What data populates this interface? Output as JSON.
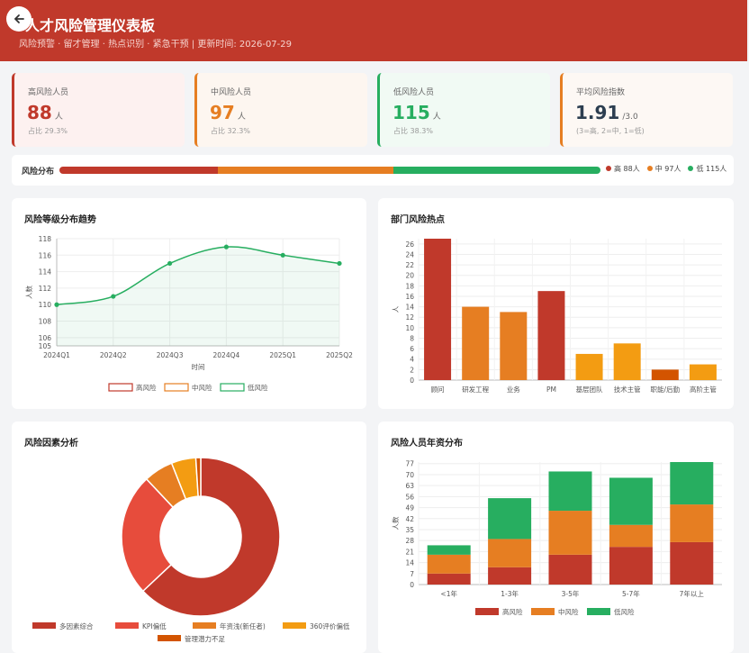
{
  "header": {
    "title": "人才风险管理仪表板",
    "subtitle": "风险预警 · 留才管理 · 热点识别 · 紧急干预 | 更新时间: 2026-07-29"
  },
  "kpis": [
    {
      "label": "高风险人员",
      "value": "88",
      "unit": "人",
      "note": "占比 29.3%",
      "color": "#c0392b",
      "bg": "#fdf1f0"
    },
    {
      "label": "中风险人员",
      "value": "97",
      "unit": "人",
      "note": "占比 32.3%",
      "color": "#e67e22",
      "bg": "#fdf6f0"
    },
    {
      "label": "低风险人员",
      "value": "115",
      "unit": "人",
      "note": "占比 38.3%",
      "color": "#27ae60",
      "bg": "#f1faf4"
    },
    {
      "label": "平均风险指数",
      "value": "1.91",
      "unit": "/3.0",
      "note": "(3=高, 2=中, 1=低)",
      "color": "#e67e22",
      "bg": "#fdf8f4"
    }
  ],
  "distribution": {
    "label": "风险分布",
    "segments": [
      {
        "name": "高",
        "count": 88,
        "text": "高 88人",
        "color": "#c0392b"
      },
      {
        "name": "中",
        "count": 97,
        "text": "中 97人",
        "color": "#e67e22"
      },
      {
        "name": "低",
        "count": 115,
        "text": "低 115人",
        "color": "#27ae60"
      }
    ]
  },
  "cards": {
    "trend_title": "风险等级分布趋势",
    "dept_title": "部门风险热点",
    "factor_title": "风险因素分析",
    "tenure_title": "风险人员年资分布"
  },
  "chart_data": [
    {
      "type": "line",
      "title": "风险等级分布趋势",
      "xlabel": "时间",
      "ylabel": "人数",
      "categories": [
        "2024Q1",
        "2024Q2",
        "2024Q3",
        "2024Q4",
        "2025Q1",
        "2025Q2"
      ],
      "yticks": [
        "105",
        "106",
        "108",
        "110",
        "112",
        "114",
        "116",
        "118"
      ],
      "ylim": [
        105,
        118
      ],
      "series": [
        {
          "name": "低风险",
          "values": [
            110,
            111,
            115,
            117,
            116,
            115
          ],
          "color": "#27ae60"
        }
      ],
      "legend": [
        {
          "name": "高风险",
          "color": "#c0392b"
        },
        {
          "name": "中风险",
          "color": "#e67e22"
        },
        {
          "name": "低风险",
          "color": "#27ae60"
        }
      ],
      "grid": true
    },
    {
      "type": "bar",
      "title": "部门风险热点",
      "ylabel": "人",
      "categories": [
        "顾问",
        "研发工程",
        "业务",
        "PM",
        "基层团队",
        "技术主管",
        "职能/后勤",
        "高阶主管"
      ],
      "values": [
        27,
        14,
        13,
        17,
        5,
        7,
        2,
        3
      ],
      "colors": [
        "#c0392b",
        "#e67e22",
        "#e67e22",
        "#c0392b",
        "#f39c12",
        "#f39c12",
        "#d35400",
        "#f39c12"
      ],
      "ylim": [
        0,
        27
      ],
      "yticks": [
        "0",
        "2",
        "4",
        "6",
        "8",
        "10",
        "12",
        "14",
        "16",
        "18",
        "20",
        "22",
        "24",
        "26"
      ],
      "grid": true
    },
    {
      "type": "pie",
      "title": "风险因素分析",
      "labels": [
        "多因素综合",
        "KPI偏低",
        "年资浅(新任者)",
        "360评价偏低",
        "管理潜力不足"
      ],
      "values": [
        63,
        25,
        6,
        5,
        1
      ],
      "colors": [
        "#c0392b",
        "#e74c3c",
        "#e67e22",
        "#f39c12",
        "#d35400"
      ]
    },
    {
      "type": "bar",
      "title": "风险人员年资分布",
      "ylabel": "人数",
      "categories": [
        "<1年",
        "1-3年",
        "3-5年",
        "5-7年",
        "7年以上"
      ],
      "series": [
        {
          "name": "高风险",
          "values": [
            7,
            11,
            19,
            24,
            27
          ],
          "color": "#c0392b"
        },
        {
          "name": "中风险",
          "values": [
            12,
            18,
            28,
            14,
            24
          ],
          "color": "#e67e22"
        },
        {
          "name": "低风险",
          "values": [
            6,
            26,
            25,
            30,
            27
          ],
          "color": "#27ae60"
        }
      ],
      "stacked": true,
      "ylim": [
        0,
        78
      ],
      "yticks": [
        "0",
        "7",
        "14",
        "21",
        "28",
        "35",
        "42",
        "49",
        "56",
        "63",
        "70",
        "77"
      ],
      "grid": true
    }
  ]
}
